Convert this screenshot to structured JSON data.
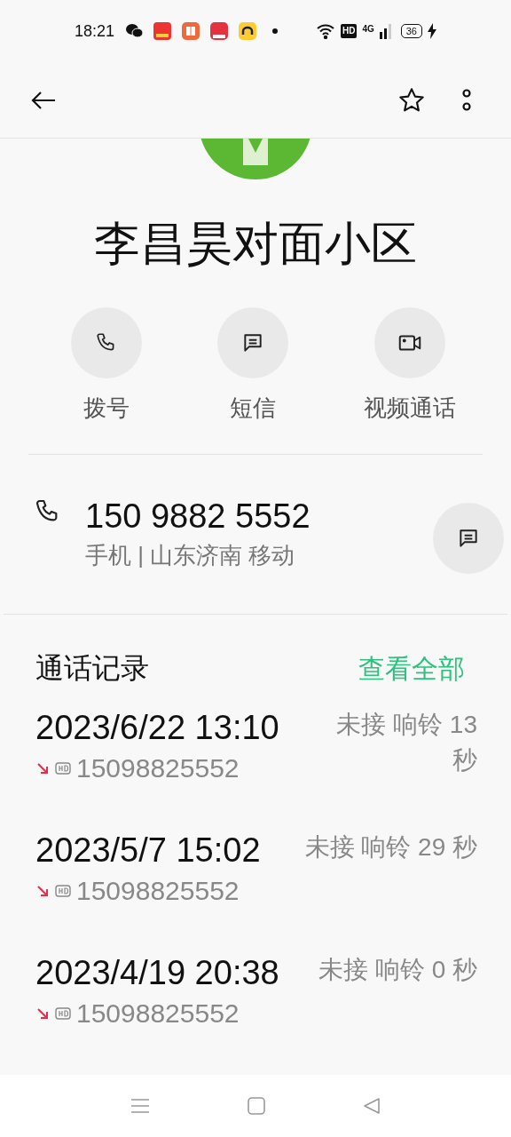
{
  "status_bar": {
    "time": "18:21",
    "hd": "HD",
    "network": "4G",
    "battery": "36"
  },
  "contact": {
    "name": "李昌昊对面小区"
  },
  "actions": [
    {
      "kind": "call",
      "label": "拨号"
    },
    {
      "kind": "message",
      "label": "短信"
    },
    {
      "kind": "video",
      "label": "视频通话"
    }
  ],
  "phone": {
    "number": "150 9882 5552",
    "detail": "手机 | 山东济南 移动"
  },
  "call_log": {
    "title": "通话记录",
    "view_all": "查看全部",
    "calls": [
      {
        "kind": "missed",
        "time": "2023/6/22 13:10",
        "number": "15098825552",
        "status": "未接 响铃 13 秒"
      },
      {
        "kind": "missed",
        "time": "2023/5/7 15:02",
        "number": "15098825552",
        "status": "未接 响铃 29 秒"
      },
      {
        "kind": "missed",
        "time": "2023/4/19 20:38",
        "number": "15098825552",
        "status": "未接 响铃 0 秒"
      }
    ]
  }
}
